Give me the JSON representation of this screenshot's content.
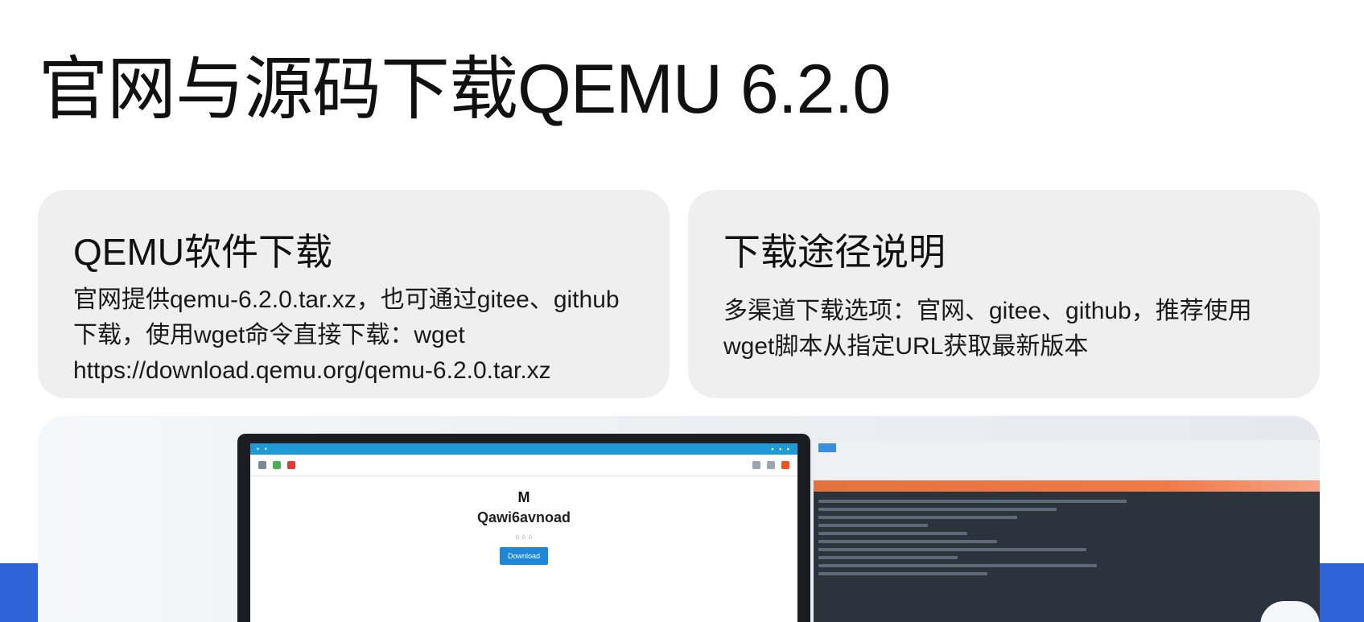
{
  "page": {
    "title": "官网与源码下载QEMU 6.2.0"
  },
  "cards": [
    {
      "title": "QEMU软件下载",
      "body": "官网提供qemu-6.2.0.tar.xz，也可通过gitee、github下载，使用wget命令直接下载：wget https://download.qemu.org/qemu-6.2.0.tar.xz"
    },
    {
      "title": "下载途径说明",
      "body": "多渠道下载选项：官网、gitee、github，推荐使用wget脚本从指定URL获取最新版本"
    }
  ],
  "hero": {
    "site_logo": "M",
    "site_heading": "Qawi6avnoad",
    "site_button": "Download"
  },
  "colors": {
    "accent_blue": "#2f64d6",
    "card_bg": "#efefef",
    "browser_bar": "#1e9bd7",
    "terminal_banner": "#e2733f"
  }
}
